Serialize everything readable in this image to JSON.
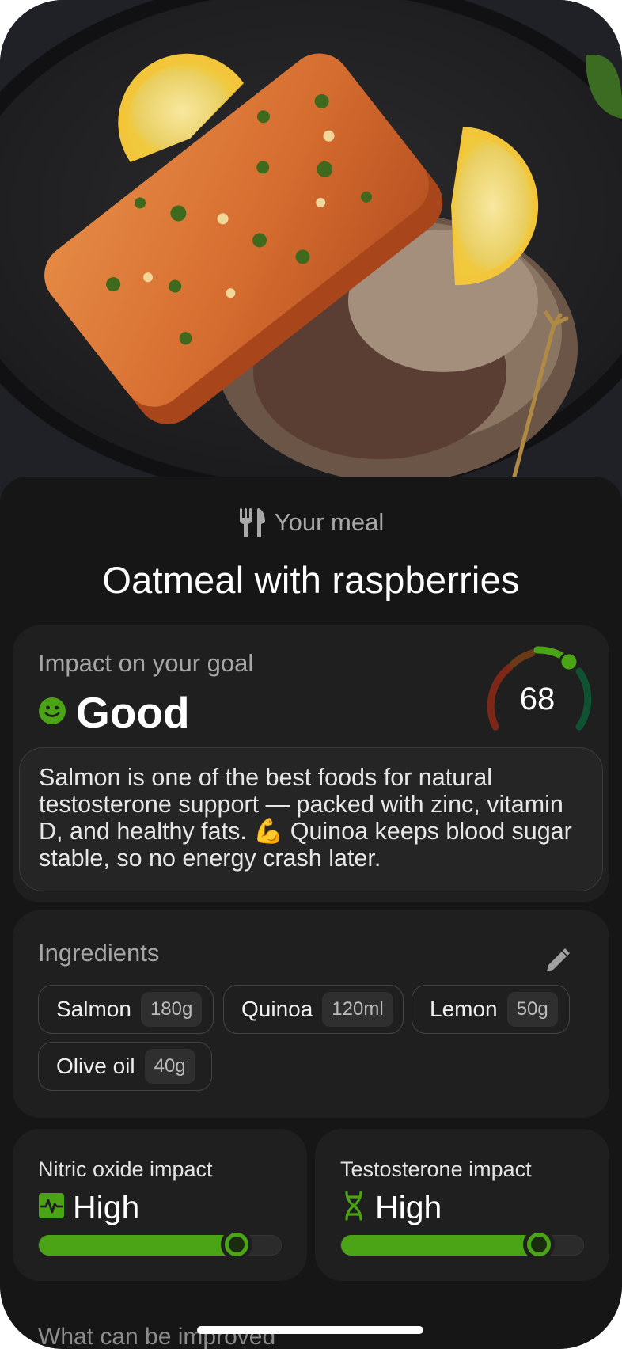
{
  "hero": {
    "image_alt": "Seared salmon fillet with herbs, lemon slices and tri-color quinoa on a dark plate"
  },
  "header": {
    "kicker": "Your meal",
    "title": "Oatmeal with raspberries",
    "kicker_icon": "fork-knife-icon"
  },
  "impact": {
    "label": "Impact on your goal",
    "verdict": "Good",
    "verdict_icon": "smiley-icon",
    "score": "68",
    "score_fraction": 0.68,
    "description": "Salmon is one of the best foods for natural testosterone support — packed with zinc, vitamin D, and healthy fats. 💪 Quinoa keeps blood sugar stable, so no energy crash later."
  },
  "ingredients": {
    "label": "Ingredients",
    "edit_icon": "pencil-icon",
    "items": [
      {
        "name": "Salmon",
        "qty": "180g"
      },
      {
        "name": "Quinoa",
        "qty": "120ml"
      },
      {
        "name": "Lemon",
        "qty": "50g"
      },
      {
        "name": "Olive oil",
        "qty": "40g"
      }
    ]
  },
  "metrics": [
    {
      "label": "Nitric oxide impact",
      "value": "High",
      "icon": "pulse-icon",
      "level": 0.8
    },
    {
      "label": "Testosterone impact",
      "value": "High",
      "icon": "dna-icon",
      "level": 0.8
    }
  ],
  "next_section": {
    "label": "What can be improved"
  },
  "colors": {
    "accent": "#4aa415",
    "background": "#161616",
    "card": "#1f1f1f"
  }
}
